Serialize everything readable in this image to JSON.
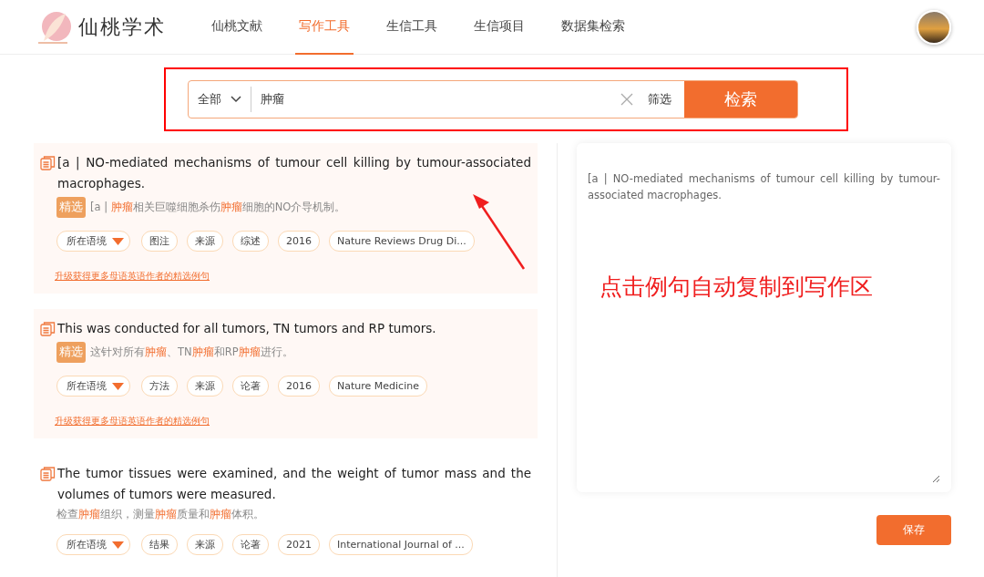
{
  "header": {
    "logo_text": "仙桃学术",
    "nav": [
      {
        "label": "仙桃文献",
        "selected": false
      },
      {
        "label": "写作工具",
        "selected": true
      },
      {
        "label": "生信工具",
        "selected": false
      },
      {
        "label": "生信项目",
        "selected": false
      },
      {
        "label": "数据集检索",
        "selected": false
      }
    ]
  },
  "search": {
    "scope": "全部",
    "value": "肿瘤",
    "filter": "筛选",
    "button": "检索"
  },
  "results": [
    {
      "featured": true,
      "sentence": "[a | NO-mediated mechanisms of tumour cell killing by tumour-associated macrophages.",
      "badge": "精选",
      "translation": [
        {
          "text": "[a | ",
          "highlight": false
        },
        {
          "text": "肿瘤",
          "highlight": true
        },
        {
          "text": "相关巨噬细胞杀伤",
          "highlight": false
        },
        {
          "text": "肿瘤",
          "highlight": true
        },
        {
          "text": "细胞的NO介导机制。",
          "highlight": false
        }
      ],
      "tags": [
        {
          "kind": "dropdown",
          "label": "所在语境"
        },
        {
          "kind": "tag",
          "label": "图注"
        },
        {
          "kind": "tag",
          "label": "来源"
        },
        {
          "kind": "tag",
          "label": "综述"
        },
        {
          "kind": "tag",
          "label": "2016"
        },
        {
          "kind": "tag",
          "label": "Nature Reviews Drug Di..."
        }
      ],
      "upgrade_link": "升级获得更多母语英语作者的精选例句"
    },
    {
      "featured": true,
      "sentence": "This was conducted for all tumors, TN tumors and RP tumors.",
      "badge": "精选",
      "translation": [
        {
          "text": "这针对所有",
          "highlight": false
        },
        {
          "text": "肿瘤",
          "highlight": true
        },
        {
          "text": "、TN",
          "highlight": false
        },
        {
          "text": "肿瘤",
          "highlight": true
        },
        {
          "text": "和RP",
          "highlight": false
        },
        {
          "text": "肿瘤",
          "highlight": true
        },
        {
          "text": "进行。",
          "highlight": false
        }
      ],
      "tags": [
        {
          "kind": "dropdown",
          "label": "所在语境"
        },
        {
          "kind": "tag",
          "label": "方法"
        },
        {
          "kind": "tag",
          "label": "来源"
        },
        {
          "kind": "tag",
          "label": "论著"
        },
        {
          "kind": "tag",
          "label": "2016"
        },
        {
          "kind": "tag",
          "label": "Nature Medicine"
        }
      ],
      "upgrade_link": "升级获得更多母语英语作者的精选例句"
    },
    {
      "featured": false,
      "sentence": "The tumor tissues were examined, and the weight of tumor mass and the volumes of tumors were measured.",
      "translation": [
        {
          "text": "检查",
          "highlight": false
        },
        {
          "text": "肿瘤",
          "highlight": true
        },
        {
          "text": "组织，测量",
          "highlight": false
        },
        {
          "text": "肿瘤",
          "highlight": true
        },
        {
          "text": "质量和",
          "highlight": false
        },
        {
          "text": "肿瘤",
          "highlight": true
        },
        {
          "text": "体积。",
          "highlight": false
        }
      ],
      "tags": [
        {
          "kind": "dropdown",
          "label": "所在语境"
        },
        {
          "kind": "tag",
          "label": "结果"
        },
        {
          "kind": "tag",
          "label": "来源"
        },
        {
          "kind": "tag",
          "label": "论著"
        },
        {
          "kind": "tag",
          "label": "2021"
        },
        {
          "kind": "tag",
          "label": "International Journal of ..."
        }
      ]
    }
  ],
  "writing_area": {
    "value": "[a | NO-mediated mechanisms of tumour cell killing by tumour-associated macrophages.",
    "save": "保存"
  },
  "annotation": {
    "text": "点击例句自动复制到写作区"
  }
}
